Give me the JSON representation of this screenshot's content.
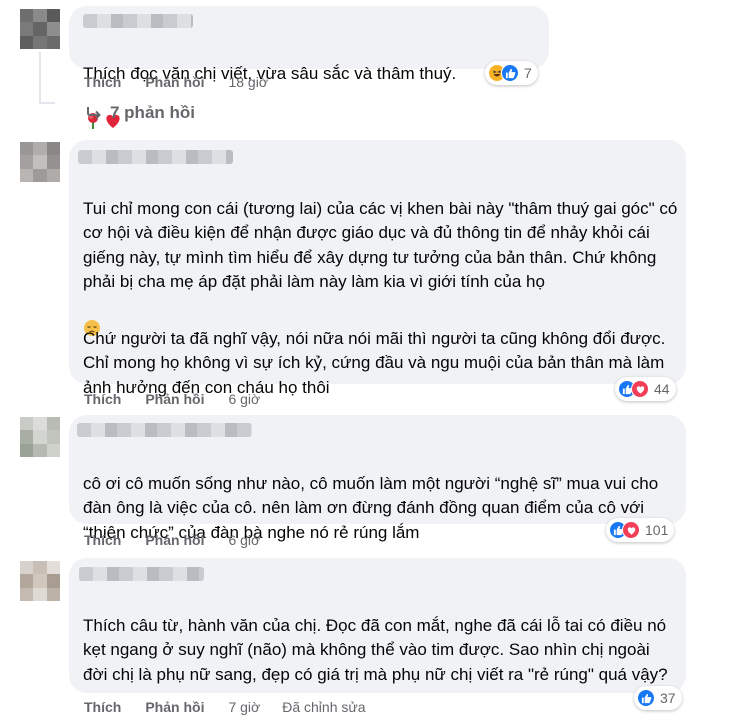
{
  "comments": [
    {
      "text": "Thích đọc văn chị viết, vừa sâu sắc và thâm thuý.",
      "actions": {
        "like": "Thích",
        "reply": "Phản hồi",
        "time": "18 giờ"
      },
      "reaction_count": "7",
      "reaction_icons": [
        "haha-icon",
        "like-icon"
      ],
      "inline_emojis": [
        "rose-icon",
        "red-heart-icon"
      ]
    },
    {
      "paragraph1": "Tui chỉ mong con cái (tương lai) của các vị khen bài này \"thâm thuý gai góc\" có cơ hội và điều kiện để nhận được giáo dục và đủ thông tin để nhảy khỏi cái giếng này, tự mình tìm hiểu để xây dựng tư tưởng của bản thân. Chứ không phải bị cha mẹ áp đặt phải làm này làm kia vì giới tính của họ",
      "paragraph2": "Chứ người ta đã nghĩ vậy, nói nữa nói mãi thì người ta cũng không đổi được. Chỉ mong họ không vì sự ích kỷ, cứng đầu và ngu muội của bản thân mà làm ảnh hưởng đến con cháu họ thôi",
      "actions": {
        "like": "Thích",
        "reply": "Phản hồi",
        "time": "6 giờ"
      },
      "reaction_count": "44",
      "reaction_icons": [
        "like-icon",
        "love-icon"
      ],
      "inline_emojis": [
        "pensive-face-icon"
      ]
    },
    {
      "text": "cô ơi cô muốn sống như nào, cô muốn làm một người “nghệ sĩ” mua vui cho đàn ông là việc của cô. nên làm ơn đừng đánh đồng quan điểm của cô với “thiên chức” của đàn bà nghe nó rẻ rúng lắm",
      "actions": {
        "like": "Thích",
        "reply": "Phản hồi",
        "time": "6 giờ"
      },
      "reaction_count": "101",
      "reaction_icons": [
        "like-icon",
        "love-icon"
      ]
    },
    {
      "text": "Thích câu từ, hành văn của chị. Đọc đã con mắt, nghe đã cái lỗ tai có điều nó kẹt ngang ở suy nghĩ (não) mà không thể vào tim được. Sao nhìn chị ngoài đời chị là phụ nữ sang, đẹp có giá trị mà phụ nữ chị viết ra \"rẻ rúng\" quá vậy?",
      "actions": {
        "like": "Thích",
        "reply": "Phản hồi",
        "time": "7 giờ",
        "edited": "Đã chỉnh sửa"
      },
      "reaction_count": "37",
      "reaction_icons": [
        "like-icon"
      ]
    }
  ],
  "replies_link": "7 phản hồi",
  "colors": {
    "bubble": "#f0f2f5",
    "secondary_text": "#65676b",
    "like_blue": "#1877f2",
    "love_red": "#f33e58",
    "haha_yellow": "#f7b125"
  }
}
